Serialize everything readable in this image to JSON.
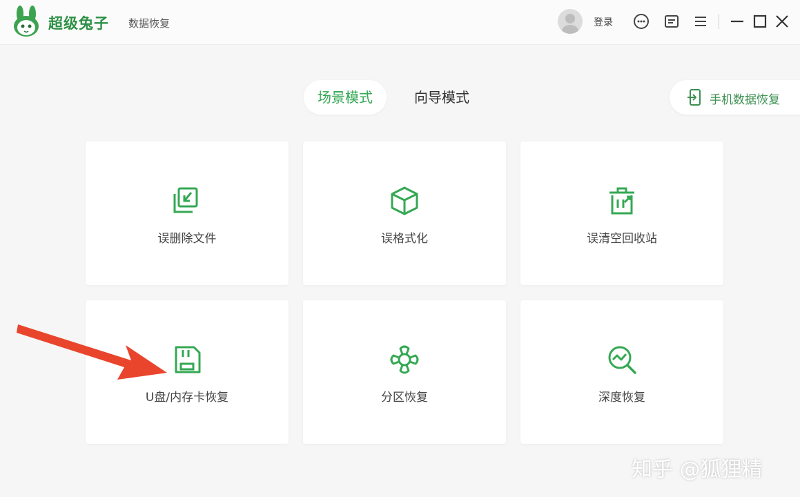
{
  "header": {
    "brand": "超级兔子",
    "product": "数据恢复",
    "login_label": "登录"
  },
  "modes": [
    {
      "label": "场景模式",
      "active": true
    },
    {
      "label": "向导模式",
      "active": false
    }
  ],
  "phone_recovery_label": "手机数据恢复",
  "cards": [
    {
      "label": "误删除文件",
      "icon": "folder-restore-icon"
    },
    {
      "label": "误格式化",
      "icon": "cube-icon"
    },
    {
      "label": "误清空回收站",
      "icon": "trash-restore-icon"
    },
    {
      "label": "U盘/内存卡恢复",
      "icon": "sd-card-icon"
    },
    {
      "label": "分区恢复",
      "icon": "partition-icon"
    },
    {
      "label": "深度恢复",
      "icon": "deep-scan-icon"
    }
  ],
  "watermark": "知乎 @狐狸精",
  "colors": {
    "accent": "#34a853",
    "annotation_arrow": "#e8452c"
  }
}
